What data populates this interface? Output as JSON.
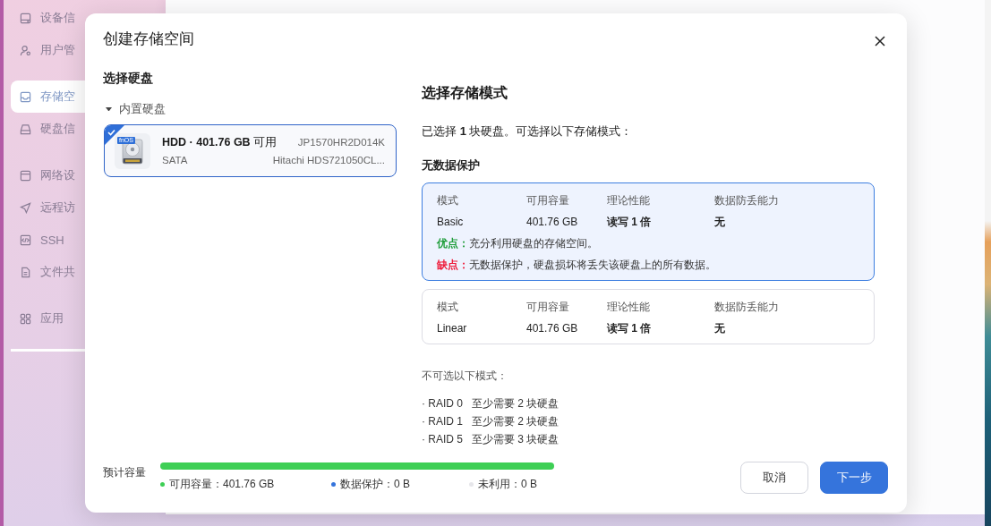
{
  "sidebar": {
    "groups": [
      {
        "items": [
          {
            "label": "设备信",
            "selected": false
          },
          {
            "label": "用户管",
            "selected": false
          }
        ]
      },
      {
        "items": [
          {
            "label": "存储空",
            "selected": true
          },
          {
            "label": "硬盘信",
            "selected": false
          }
        ]
      },
      {
        "items": [
          {
            "label": "网络设",
            "selected": false
          },
          {
            "label": "远程访",
            "selected": false
          },
          {
            "label": "SSH",
            "selected": false
          },
          {
            "label": "文件共",
            "selected": false
          }
        ]
      },
      {
        "items": [
          {
            "label": "应用",
            "selected": false
          }
        ]
      }
    ]
  },
  "dialog": {
    "title": "创建存储空间",
    "disk_panel": {
      "heading": "选择硬盘",
      "group": {
        "label": "内置硬盘",
        "expanded": true,
        "disks": [
          {
            "selected": true,
            "badge": "fnOS",
            "title": "**HDD · 401.76 GB** 可用",
            "serial": "JP1570HR2D014K",
            "interface": "SATA",
            "model": "Hitachi HDS721050CL..."
          }
        ]
      }
    },
    "mode_panel": {
      "heading": "选择存储模式",
      "summary": "已选择 **1** 块硬盘。可选择以下存储模式：",
      "section": "无数据保护",
      "modes": [
        {
          "selected": true,
          "cells": [
            {
              "header": "模式",
              "value": "Basic"
            },
            {
              "header": "可用容量",
              "value": "401.76 GB"
            },
            {
              "header": "理论性能",
              "value": "读写 1 倍"
            },
            {
              "header": "数据防丢能力",
              "value": "无"
            }
          ],
          "notes": [
            {
              "kind": "pro",
              "text": "**优点：**充分利用硬盘的存储空间。"
            },
            {
              "kind": "con",
              "text": "**缺点：**无数据保护，硬盘损坏将丢失该硬盘上的所有数据。"
            }
          ]
        },
        {
          "selected": false,
          "cells": [
            {
              "header": "模式",
              "value": "Linear"
            },
            {
              "header": "可用容量",
              "value": "401.76 GB"
            },
            {
              "header": "理论性能",
              "value": "读写 1 倍"
            },
            {
              "header": "数据防丢能力",
              "value": "无"
            }
          ]
        }
      ],
      "unavailable_heading": "不可选以下模式：",
      "unavailable": [
        {
          "name": "· RAID 0",
          "requirement": "至少需要 2 块硬盘"
        },
        {
          "name": "· RAID 1",
          "requirement": "至少需要 2 块硬盘"
        },
        {
          "name": "· RAID 5",
          "requirement": "至少需要 3 块硬盘"
        }
      ]
    },
    "footer": {
      "label": "预计容量",
      "legend": [
        {
          "label": "可用容量：401.76 GB",
          "color": "#3ecf55",
          "level": 1
        },
        {
          "label": "数据保护：0 B",
          "color": "#3574dc"
        },
        {
          "label": "未利用：0 B",
          "color": "#e6e6ea"
        }
      ],
      "buttons": [
        {
          "label": "取消",
          "kind": "secondary"
        },
        {
          "label": "下一步",
          "kind": "primary"
        }
      ]
    }
  }
}
